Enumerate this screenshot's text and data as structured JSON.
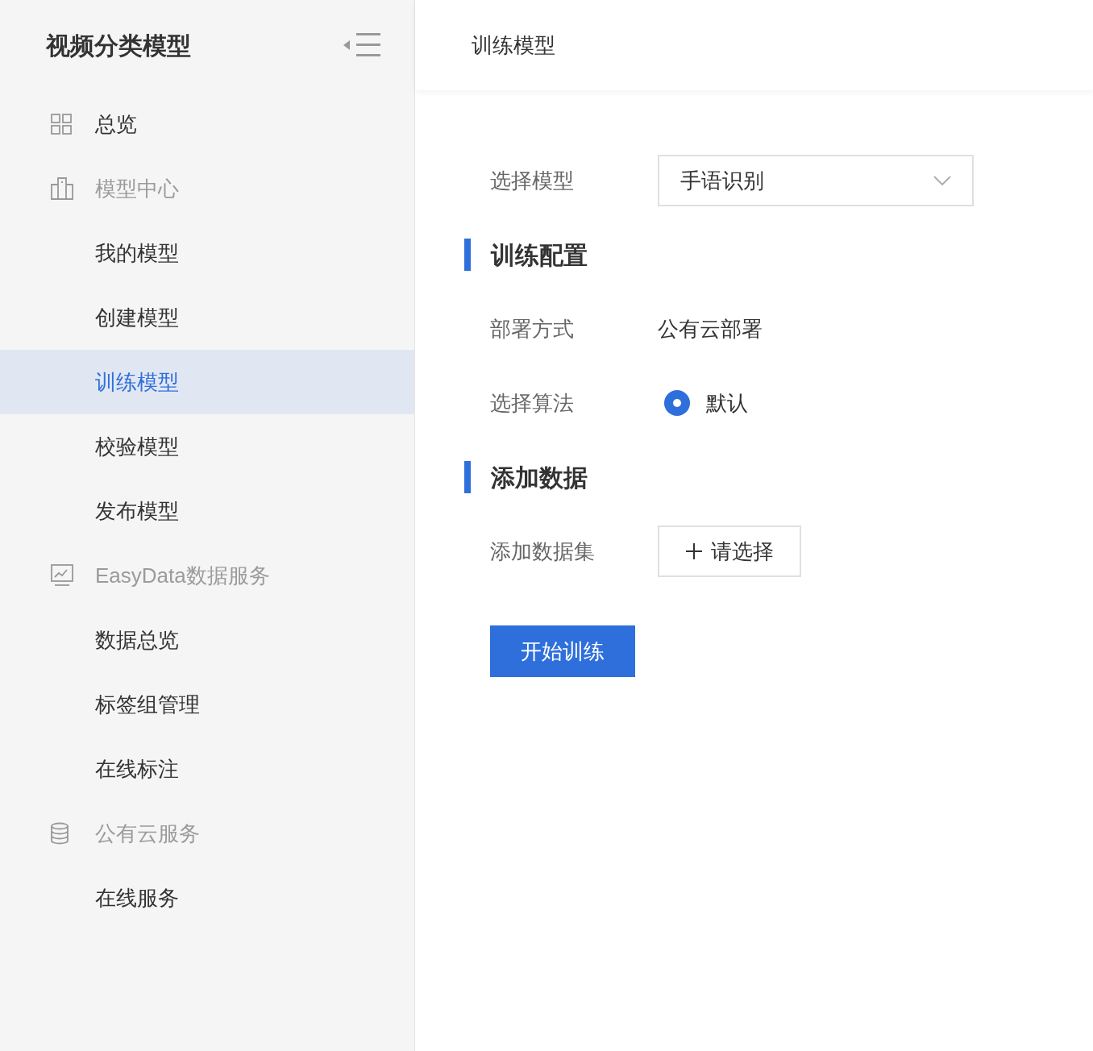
{
  "sidebar": {
    "title": "视频分类模型",
    "items": [
      {
        "kind": "top",
        "label": "总览",
        "selected": false
      },
      {
        "kind": "group",
        "label": "模型中心",
        "children": [
          {
            "label": "我的模型",
            "selected": false
          },
          {
            "label": "创建模型",
            "selected": false
          },
          {
            "label": "训练模型",
            "selected": true
          },
          {
            "label": "校验模型",
            "selected": false
          },
          {
            "label": "发布模型",
            "selected": false
          }
        ]
      },
      {
        "kind": "group",
        "label": "EasyData数据服务",
        "children": [
          {
            "label": "数据总览",
            "selected": false
          },
          {
            "label": "标签组管理",
            "selected": false
          },
          {
            "label": "在线标注",
            "selected": false
          }
        ]
      },
      {
        "kind": "group",
        "label": "公有云服务",
        "children": [
          {
            "label": "在线服务",
            "selected": false
          }
        ]
      }
    ]
  },
  "header": {
    "title": "训练模型"
  },
  "form": [
    {
      "kind": "select",
      "label": "选择模型",
      "value": "手语识别"
    },
    {
      "kind": "section",
      "label": "训练配置"
    },
    {
      "kind": "text",
      "label": "部署方式",
      "value": "公有云部署"
    },
    {
      "kind": "radio",
      "label": "选择算法",
      "options": [
        {
          "label": "默认",
          "selected": true
        }
      ]
    },
    {
      "kind": "section",
      "label": "添加数据"
    },
    {
      "kind": "picker",
      "label": "添加数据集",
      "button": "请选择"
    }
  ],
  "submit": "开始训练"
}
